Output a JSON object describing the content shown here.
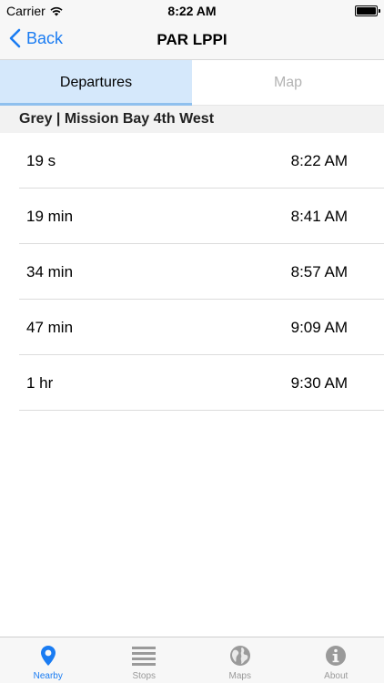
{
  "status": {
    "carrier": "Carrier",
    "time": "8:22 AM"
  },
  "nav": {
    "back_label": "Back",
    "title": "PAR LPPI"
  },
  "tabs": [
    {
      "label": "Departures",
      "active": true
    },
    {
      "label": "Map",
      "active": false
    }
  ],
  "section": {
    "title": "Grey | Mission Bay 4th West"
  },
  "departures": [
    {
      "relative": "19 s",
      "time": "8:22 AM"
    },
    {
      "relative": "19 min",
      "time": "8:41 AM"
    },
    {
      "relative": "34 min",
      "time": "8:57 AM"
    },
    {
      "relative": "47 min",
      "time": "9:09 AM"
    },
    {
      "relative": "1 hr",
      "time": "9:30 AM"
    }
  ],
  "tab_bar": {
    "items": [
      {
        "label": "Nearby",
        "icon": "location-pin-icon",
        "active": true
      },
      {
        "label": "Stops",
        "icon": "list-icon",
        "active": false
      },
      {
        "label": "Maps",
        "icon": "globe-icon",
        "active": false
      },
      {
        "label": "About",
        "icon": "info-icon",
        "active": false
      }
    ]
  },
  "colors": {
    "accent": "#1a7cf2",
    "active_tab_bg": "#d5e8fb",
    "inactive_gray": "#9a9a9a"
  }
}
